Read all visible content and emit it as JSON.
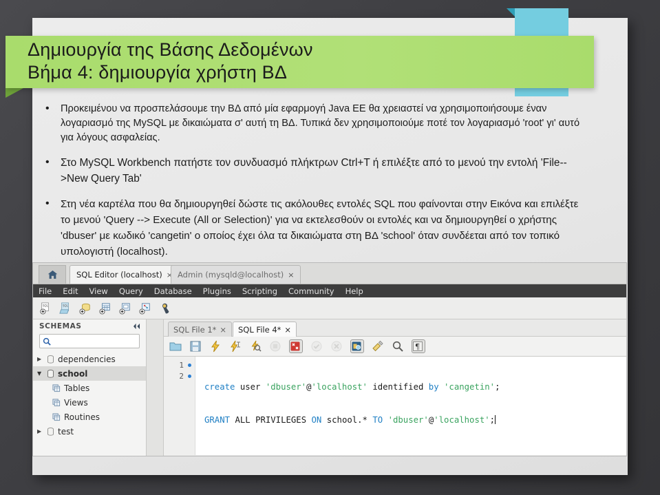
{
  "slide": {
    "title_lines": [
      "Δημιουργία της Βάσης Δεδομένων",
      "Βήμα 4: δημιουργία χρήστη ΒΔ"
    ],
    "bullets": [
      "Προκειμένου να προσπελάσουμε την ΒΔ από μία εφαρμογή Java EE θα χρειαστεί να χρησιμοποιήσουμε έναν λογαριασμό της MySQL με δικαιώματα σ' αυτή τη ΒΔ. Τυπικά δεν χρησιμοποιούμε ποτέ τον λογαριασμό 'root' γι' αυτό για λόγους ασφαλείας.",
      "Στο MySQL Workbench πατήστε τον συνδυασμό πλήκτρων Ctrl+T ή επιλέξτε από το μενού την εντολή 'File-->New Query Tab'",
      "Στη νέα καρτέλα που θα δημιουργηθεί δώστε τις ακόλουθες εντολές SQL που φαίνονται στην Εικόνα και επιλέξτε το μενού 'Query --> Execute (All or Selection)' για να εκτελεσθούν οι εντολές και να δημιουργηθεί ο χρήστης 'dbuser' με κωδικό 'cangetin' ο οποίος έχει όλα τα δικαιώματα στη ΒΔ 'school' όταν συνδέεται από τον τοπικό υπολογιστή (localhost)."
    ],
    "colors": {
      "title_banner": "#aadc6e",
      "ribbon": "#74cde0",
      "background": "#46464a",
      "sheet": "#ececec"
    }
  },
  "workbench": {
    "tabs": [
      {
        "label": "SQL Editor (localhost)",
        "close": "×",
        "active": true
      },
      {
        "label": "Admin (mysqld@localhost)",
        "close": "×",
        "active": false
      }
    ],
    "home_icon": "home-icon",
    "menu": [
      "File",
      "Edit",
      "View",
      "Query",
      "Database",
      "Plugins",
      "Scripting",
      "Community",
      "Help"
    ],
    "main_toolbar_icons": [
      "new-sql-file-icon",
      "open-sql-file-icon",
      "new-schema-icon",
      "new-table-icon",
      "new-view-icon",
      "new-routine-icon",
      "security-icon"
    ],
    "sidebar": {
      "header": "SCHEMAS",
      "header_icon": "collapse-panel-icon",
      "search": {
        "value": "",
        "placeholder": "",
        "icon": "search-icon"
      },
      "tree": [
        {
          "label": "dependencies",
          "level": 0,
          "expanded": false,
          "selected": false,
          "icon": "schema-icon"
        },
        {
          "label": "school",
          "level": 0,
          "expanded": true,
          "selected": true,
          "icon": "schema-icon"
        },
        {
          "label": "Tables",
          "level": 1,
          "expanded": null,
          "selected": false,
          "icon": "tables-icon"
        },
        {
          "label": "Views",
          "level": 1,
          "expanded": null,
          "selected": false,
          "icon": "views-icon"
        },
        {
          "label": "Routines",
          "level": 1,
          "expanded": null,
          "selected": false,
          "icon": "routines-icon"
        },
        {
          "label": "test",
          "level": 0,
          "expanded": false,
          "selected": false,
          "icon": "schema-icon"
        }
      ]
    },
    "editor": {
      "tabs": [
        {
          "label": "SQL File 1*",
          "close": "×",
          "active": false
        },
        {
          "label": "SQL File 4*",
          "close": "×",
          "active": true
        }
      ],
      "toolbar_icons": [
        "open-file-icon",
        "save-file-icon",
        "execute-icon",
        "execute-current-statement-icon",
        "explain-query-icon",
        "stop-query-icon",
        "toggle-stop-on-error-icon",
        "commit-icon",
        "rollback-icon",
        "autocommit-icon",
        "beautify-query-icon",
        "find-icon",
        "show-invisible-chars-icon"
      ],
      "lines": [
        {
          "number": "1",
          "marker": "●",
          "tokens": [
            {
              "t": "create",
              "c": "kw"
            },
            {
              "t": " ",
              "c": "pl"
            },
            {
              "t": "user",
              "c": "pl"
            },
            {
              "t": " ",
              "c": "pl"
            },
            {
              "t": "'dbuser'",
              "c": "str"
            },
            {
              "t": "@",
              "c": "at"
            },
            {
              "t": "'localhost'",
              "c": "str"
            },
            {
              "t": " ",
              "c": "pl"
            },
            {
              "t": "identified",
              "c": "pl"
            },
            {
              "t": " ",
              "c": "pl"
            },
            {
              "t": "by",
              "c": "kw"
            },
            {
              "t": " ",
              "c": "pl"
            },
            {
              "t": "'cangetin'",
              "c": "str"
            },
            {
              "t": ";",
              "c": "pl"
            }
          ]
        },
        {
          "number": "2",
          "marker": "●",
          "tokens": [
            {
              "t": "GRANT",
              "c": "kw"
            },
            {
              "t": " ",
              "c": "pl"
            },
            {
              "t": "ALL",
              "c": "pl"
            },
            {
              "t": " ",
              "c": "pl"
            },
            {
              "t": "PRIVILEGES",
              "c": "pl"
            },
            {
              "t": " ",
              "c": "pl"
            },
            {
              "t": "ON",
              "c": "kw"
            },
            {
              "t": " ",
              "c": "pl"
            },
            {
              "t": "school.*",
              "c": "pl"
            },
            {
              "t": " ",
              "c": "pl"
            },
            {
              "t": "TO",
              "c": "kw"
            },
            {
              "t": " ",
              "c": "pl"
            },
            {
              "t": "'dbuser'",
              "c": "str"
            },
            {
              "t": "@",
              "c": "at"
            },
            {
              "t": "'localhost'",
              "c": "str"
            },
            {
              "t": ";",
              "c": "pl"
            }
          ]
        }
      ],
      "colors": {
        "keyword": "#1f7fc4",
        "string": "#3aa35f",
        "plain": "#1b1b1b"
      }
    }
  }
}
